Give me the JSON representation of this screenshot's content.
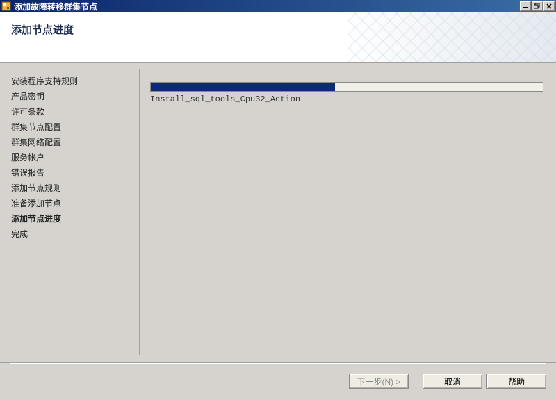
{
  "window": {
    "title": "添加故障转移群集节点"
  },
  "header": {
    "title": "添加节点进度"
  },
  "sidebar": {
    "steps": [
      {
        "label": "安装程序支持规则",
        "active": false
      },
      {
        "label": "产品密钥",
        "active": false
      },
      {
        "label": "许可条款",
        "active": false
      },
      {
        "label": "群集节点配置",
        "active": false
      },
      {
        "label": "群集网络配置",
        "active": false
      },
      {
        "label": "服务帐户",
        "active": false
      },
      {
        "label": "错误报告",
        "active": false
      },
      {
        "label": "添加节点规则",
        "active": false
      },
      {
        "label": "准备添加节点",
        "active": false
      },
      {
        "label": "添加节点进度",
        "active": true
      },
      {
        "label": "完成",
        "active": false
      }
    ]
  },
  "progress": {
    "percent": 47,
    "status_text": "Install_sql_tools_Cpu32_Action"
  },
  "footer": {
    "next_label": "下一步(N) >",
    "cancel_label": "取消",
    "help_label": "帮助"
  }
}
